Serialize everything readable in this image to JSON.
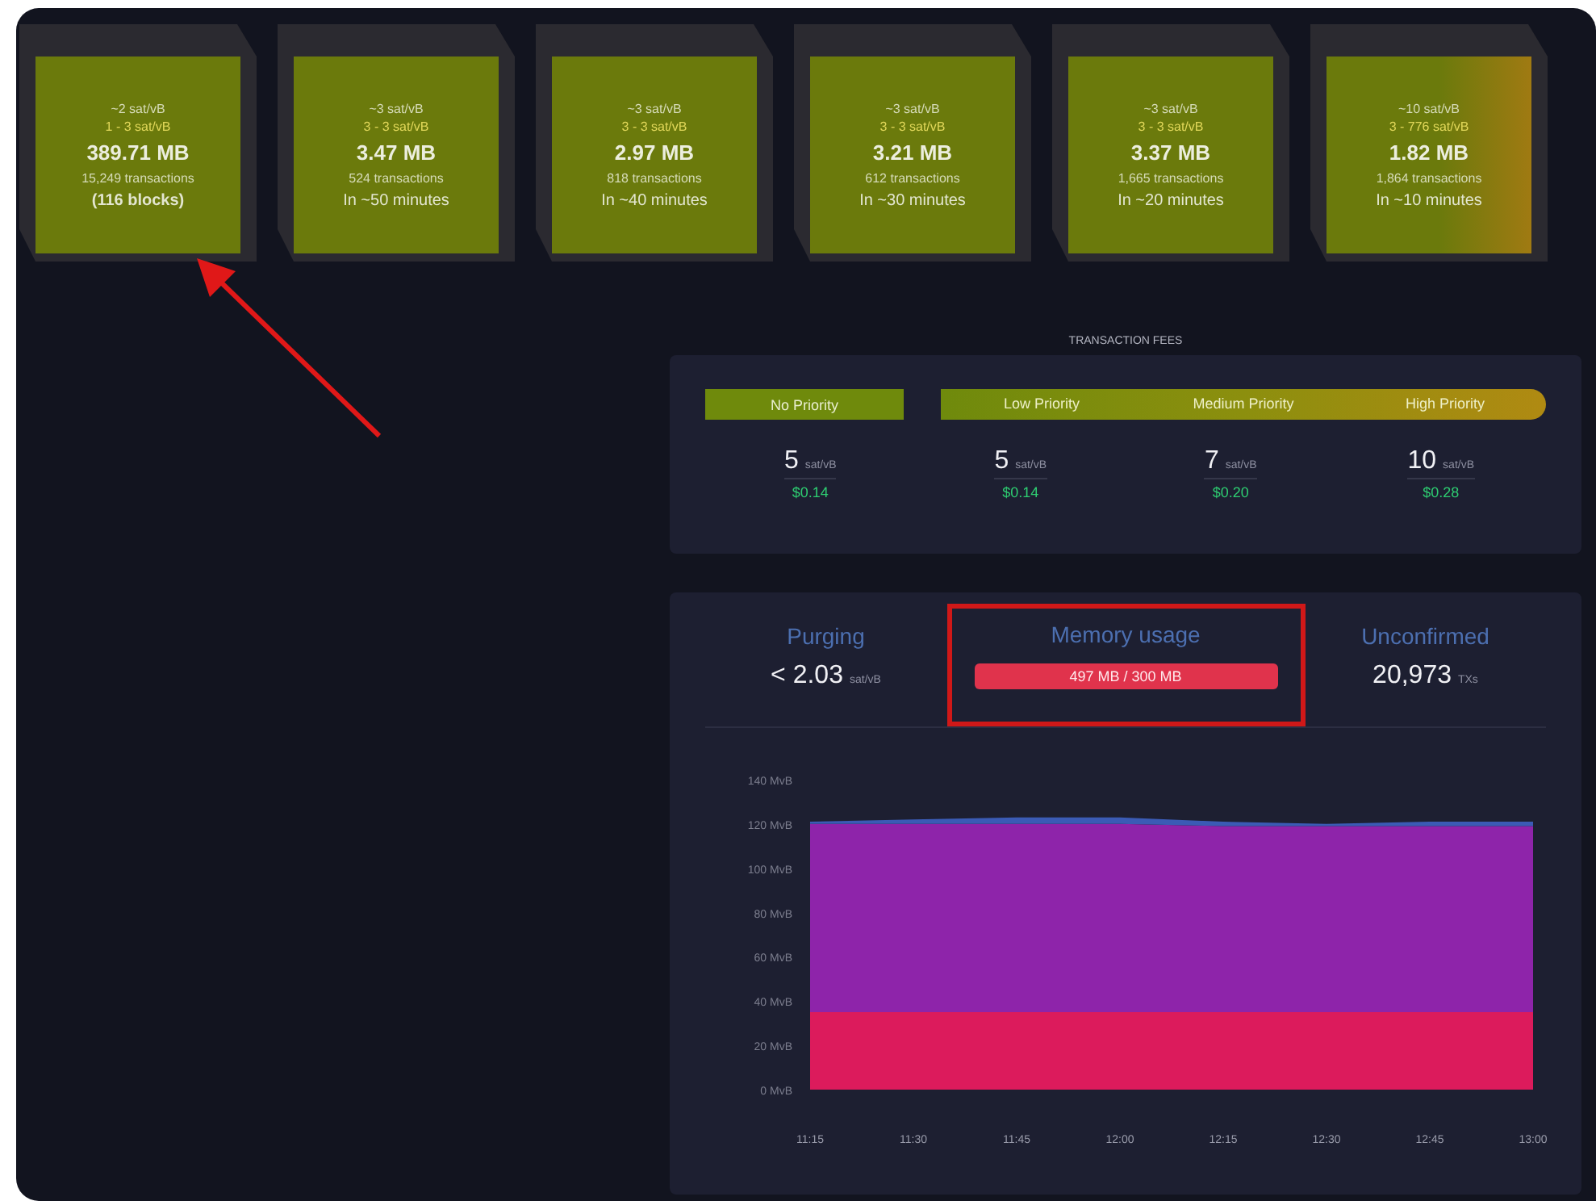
{
  "blocks": [
    {
      "median_fee": "~2 sat/vB",
      "fee_range": "1 - 3 sat/vB",
      "size": "389.71 MB",
      "transactions": "15,249 transactions",
      "eta": "(116 blocks)",
      "kind": "stack",
      "color": "#6b7a0c"
    },
    {
      "median_fee": "~3 sat/vB",
      "fee_range": "3 - 3 sat/vB",
      "size": "3.47 MB",
      "transactions": "524 transactions",
      "eta": "In ~50 minutes",
      "kind": "block",
      "color": "#6b7a0c"
    },
    {
      "median_fee": "~3 sat/vB",
      "fee_range": "3 - 3 sat/vB",
      "size": "2.97 MB",
      "transactions": "818 transactions",
      "eta": "In ~40 minutes",
      "kind": "block",
      "color": "#6b7a0c"
    },
    {
      "median_fee": "~3 sat/vB",
      "fee_range": "3 - 3 sat/vB",
      "size": "3.21 MB",
      "transactions": "612 transactions",
      "eta": "In ~30 minutes",
      "kind": "block",
      "color": "#6b7a0c"
    },
    {
      "median_fee": "~3 sat/vB",
      "fee_range": "3 - 3 sat/vB",
      "size": "3.37 MB",
      "transactions": "1,665 transactions",
      "eta": "In ~20 minutes",
      "kind": "block",
      "color": "#6b7a0c"
    },
    {
      "median_fee": "~10 sat/vB",
      "fee_range": "3 - 776 sat/vB",
      "size": "1.82 MB",
      "transactions": "1,864 transactions",
      "eta": "In ~10 minutes",
      "kind": "block",
      "color": "#a07a12"
    }
  ],
  "transaction_fees": {
    "title": "TRANSACTION FEES",
    "fees": [
      {
        "label": "No Priority",
        "value": "5",
        "unit": "sat/vB",
        "usd": "$0.14"
      },
      {
        "label": "Low Priority",
        "value": "5",
        "unit": "sat/vB",
        "usd": "$0.14"
      },
      {
        "label": "Medium Priority",
        "value": "7",
        "unit": "sat/vB",
        "usd": "$0.20"
      },
      {
        "label": "High Priority",
        "value": "10",
        "unit": "sat/vB",
        "usd": "$0.28"
      }
    ]
  },
  "mempool": {
    "purging": {
      "label": "Purging",
      "value": "< 2.03",
      "unit": "sat/vB"
    },
    "memory_usage": {
      "label": "Memory usage",
      "reading": "497 MB / 300 MB",
      "level": 1
    },
    "unconfirmed": {
      "label": "Unconfirmed",
      "value": "20,973",
      "unit": "TXs"
    },
    "chart_data": {
      "type": "area",
      "stacked": true,
      "categories": [
        "11:15",
        "11:30",
        "11:45",
        "12:00",
        "12:15",
        "12:30",
        "12:45",
        "13:00"
      ],
      "series": [
        {
          "color": "#dc1b5c",
          "values": [
            35,
            35,
            35,
            35,
            35,
            35,
            35,
            35
          ]
        },
        {
          "color": "#8e24aa",
          "values": [
            85,
            85,
            85,
            85,
            84,
            84,
            84,
            84
          ]
        },
        {
          "color": "#3b5bb5",
          "values": [
            1,
            2,
            3,
            3,
            2,
            1,
            2,
            2
          ]
        }
      ],
      "ylim": [
        0,
        140
      ],
      "yticks": [
        {
          "value": 0,
          "label": "0 MvB"
        },
        {
          "value": 20,
          "label": "20 MvB"
        },
        {
          "value": 40,
          "label": "40 MvB"
        },
        {
          "value": 60,
          "label": "60 MvB"
        },
        {
          "value": 80,
          "label": "80 MvB"
        },
        {
          "value": 100,
          "label": "100 MvB"
        },
        {
          "value": 120,
          "label": "120 MvB"
        },
        {
          "value": 140,
          "label": "140 MvB"
        }
      ]
    }
  }
}
